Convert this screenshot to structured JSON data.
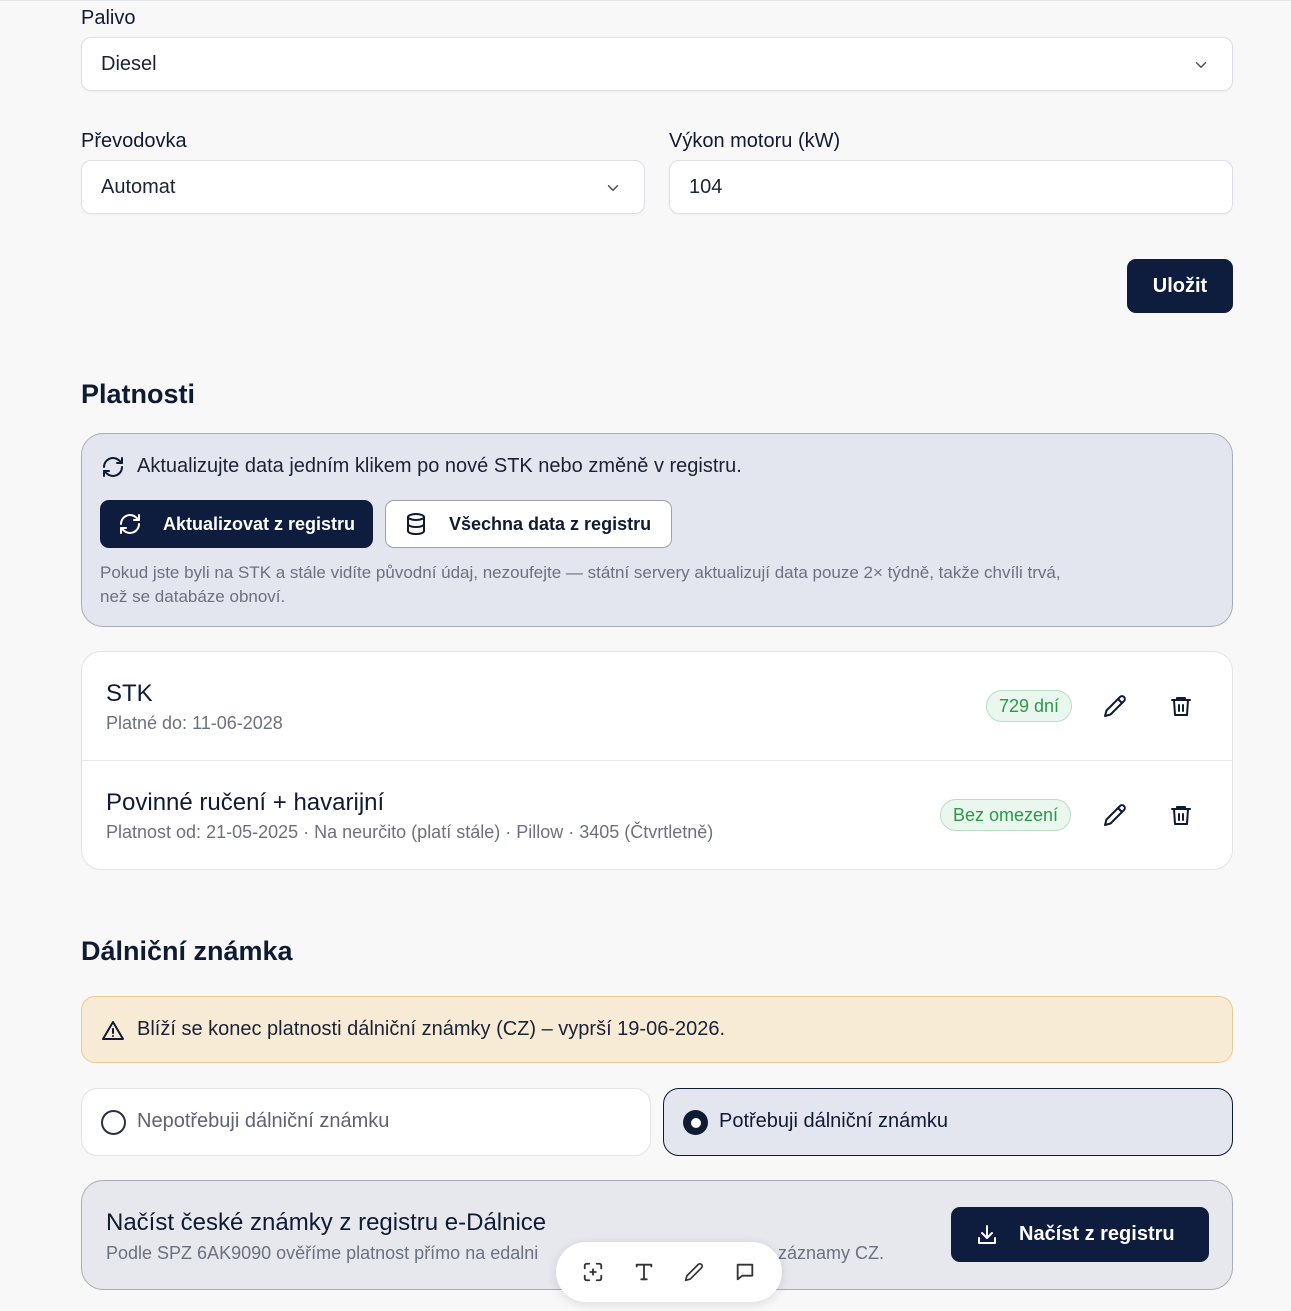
{
  "form": {
    "fuel_label": "Palivo",
    "fuel_value": "Diesel",
    "gearbox_label": "Převodovka",
    "gearbox_value": "Automat",
    "power_label": "Výkon motoru (kW)",
    "power_value": "104",
    "save_label": "Uložit"
  },
  "validity": {
    "title": "Platnosti",
    "info_text": "Aktualizujte data jedním klikem po nové STK nebo změně v registru.",
    "update_button": "Aktualizovat z registru",
    "all_data_button": "Všechna data z registru",
    "note_line1": "Pokud jste byli na STK a stále vidíte původní údaj, nezoufejte — státní servery aktualizují data pouze 2× týdně, takže chvíli trvá,",
    "note_line2": "než se databáze obnoví.",
    "items": [
      {
        "title": "STK",
        "subtitle": "Platné do: 11-06-2028",
        "badge": "729 dní"
      },
      {
        "title": "Povinné ručení + havarijní",
        "subtitle": "Platnost od: 21-05-2025 · Na neurčito (platí stále) · Pillow · 3405 (Čtvrtletně)",
        "badge": "Bez omezení"
      }
    ]
  },
  "vignette": {
    "title": "Dálniční známka",
    "warning": "Blíží se konec platnosti dálniční známky (CZ) – vyprší 19-06-2026.",
    "option_no": "Nepotřebuji dálniční známku",
    "option_yes": "Potřebuji dálniční známku",
    "selected": "yes",
    "load_title": "Načíst české známky z registru e-Dálnice",
    "load_desc_left": "Podle SPZ 6AK9090 ověříme platnost přímo na edalni",
    "load_desc_right": "záznamy CZ.",
    "load_button": "Načíst z registru"
  },
  "toolbar": {
    "icons": [
      "screenshot-icon",
      "text-icon",
      "pencil-icon",
      "comment-icon"
    ]
  },
  "colors": {
    "primary": "#0e1d3d",
    "badge_green": "#2b9948",
    "warning_bg": "#f7ebd6"
  }
}
